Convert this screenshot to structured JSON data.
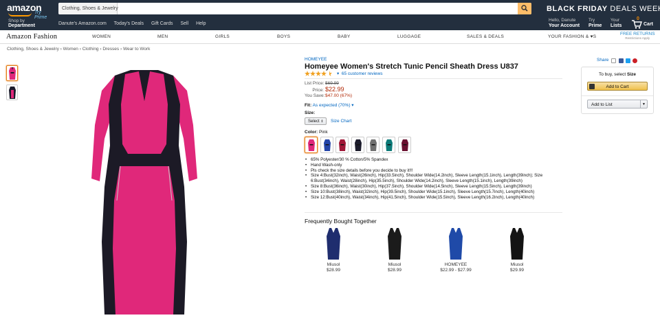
{
  "header": {
    "logo_text": "amazon",
    "logo_sub": "Try Prime",
    "search_category": "Clothing, Shoes & Jewelry",
    "search_placeholder": "",
    "promo_bold": "BLACK FRIDAY",
    "promo_rest": " DEALS WEEK ❯",
    "shop_by_line1": "Shop by",
    "shop_by_line2": "Department",
    "links": [
      "Danute's Amazon.com",
      "Today's Deals",
      "Gift Cards",
      "Sell",
      "Help"
    ],
    "account_line1": "Hello, Danute",
    "account_line2": "Your Account",
    "prime_line1": "Try",
    "prime_line2": "Prime",
    "lists_line1": "Your",
    "lists_line2": "Lists",
    "cart_count": "0",
    "cart_label": "Cart"
  },
  "fashion_nav": {
    "brand": "Amazon Fashion",
    "items": [
      "WOMEN",
      "MEN",
      "GIRLS",
      "BOYS",
      "BABY",
      "LUGGAGE",
      "SALES & DEALS",
      "YOUR FASHION & ♥S"
    ],
    "free_returns": "FREE RETURNS",
    "free_returns_sub": "Restrictions Apply"
  },
  "breadcrumb": "Clothing, Shoes & Jewelry › Women › Clothing › Dresses › Wear to Work",
  "product": {
    "brand": "HOMEYEE",
    "title": "Homeyee Women's Stretch Tunic Pencil Sheath Dress U837",
    "rating": 4.5,
    "reviews": "65 customer reviews",
    "list_price_label": "List Price:",
    "list_price": "$69.99",
    "price_label": "Price:",
    "price": "$22.99",
    "save_label": "You Save:",
    "save": "$47.00 (67%)",
    "fit_label": "Fit:",
    "fit_value": "As expected (70%)",
    "size_label": "Size:",
    "size_select": "Select",
    "size_chart": "Size Chart",
    "color_label": "Color:",
    "color_value": "Pink",
    "swatches": [
      "#e0287a",
      "#2445a8",
      "#a01838",
      "#1c1c2c",
      "#707070",
      "#0d7a78",
      "#6a1030"
    ],
    "bullets": [
      "65% Polyester/30 % Cotton/5% Spandex",
      "Hand Wash-only",
      "Pls check the size details before you decide to buy it!!!",
      "Size 4:Bust(32inch), Waist(26inch), Hip(33.5inch), Shoulder Wide(14.2inch), Sleeve Length(15.1inch), Length(39inch); Size 6:Bust(34inch), Waist(28inch), Hip(35.5inch), Shoulder Wide(14.2inch), Sleeve Length(15.1inch), Length(39inch)",
      "Size 8:Bust(36inch), Waist(30inch), Hip(37.5inch), Shoulder Wide(14.5inch), Sleeve Length(15.5inch), Length(39inch)",
      "Size 10:Bust(38inch), Waist(32inch), Hip(39.5inch), Shoulder Wide(15.1inch), Sleeve Length(15.7inch), Length(40inch)",
      "Size 12:Bust(40inch), Waist(34inch), Hip(41.5inch), Shoulder Wide(15.5inch), Sleeve Length(16.2inch), Length(40inch)"
    ]
  },
  "fbt": {
    "title": "Frequently Bought Together",
    "items": [
      {
        "name": "Miusol",
        "price": "$28.99",
        "color": "#1f2d6e"
      },
      {
        "name": "Miusol",
        "price": "$28.99",
        "color": "#1b1b1b"
      },
      {
        "name": "HOMEYEE",
        "price": "$22.99 - $27.99",
        "color": "#1f4aa8"
      },
      {
        "name": "Miusol",
        "price": "$29.99",
        "color": "#141414"
      }
    ]
  },
  "share": {
    "label": "Share"
  },
  "buybox": {
    "to_buy_prefix": "To buy, select ",
    "to_buy_bold": "Size",
    "add_to_cart": "Add to Cart",
    "add_to_list": "Add to List"
  }
}
